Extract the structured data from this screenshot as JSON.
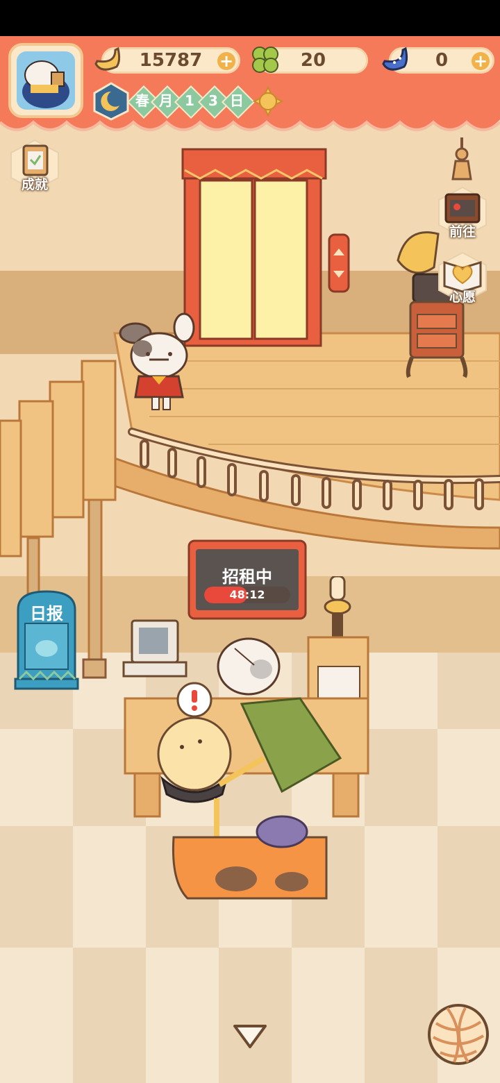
{
  "hud": {
    "bananas": "15787",
    "clovers": "20",
    "gems": "0",
    "date_chars": [
      "春",
      "月",
      "1",
      "3",
      "日"
    ],
    "weather_icon": "sun-icon"
  },
  "side_buttons": {
    "achievements": "成就",
    "goto": "前往",
    "wish": "心愿"
  },
  "sign": {
    "title": "招租中",
    "timer": "48:12",
    "progress": 0.5
  },
  "newspaper": {
    "label": "日报"
  },
  "colors": {
    "banner": "#f47a5a",
    "wall": "#f2d9b3",
    "floor_wood": "#f1c383",
    "tile_light": "#f4e6cf",
    "tile_dark": "#ead6b7",
    "accent_red": "#e8493b"
  }
}
